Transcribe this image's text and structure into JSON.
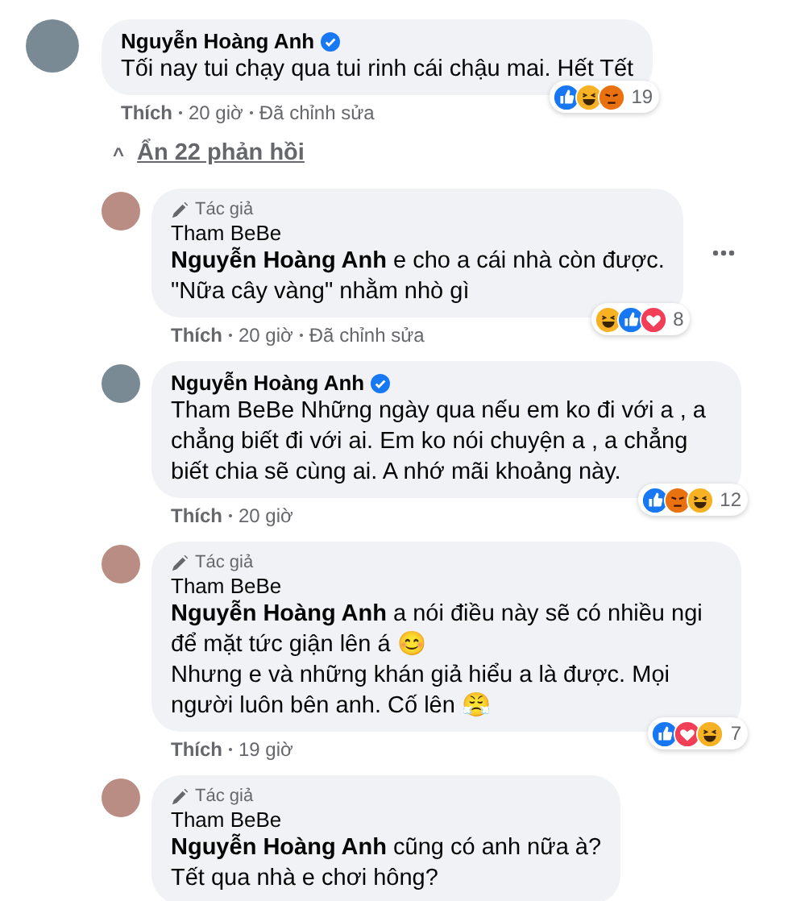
{
  "comment": {
    "author": "Nguyễn Hoàng Anh",
    "verified": true,
    "text": "Tối nay tui chạy qua tui rinh cái chậu mai. Hết Tết",
    "reactions": [
      {
        "kind": "like"
      },
      {
        "kind": "haha"
      },
      {
        "kind": "angry"
      }
    ],
    "reaction_count": "19",
    "meta": [
      "Thích",
      "20 giờ",
      "Đã chỉnh sửa"
    ]
  },
  "toggle_replies": {
    "icon": "^",
    "label": "Ẩn 22 phản hồi"
  },
  "replies": [
    {
      "badge": "Tác giả",
      "author": "Tham BeBe",
      "text": "**Nguyễn Hoàng Anh** e cho a cái nhà còn được.\n\"Nữa cây vàng\" nhằm nhò gì",
      "reactions": [
        {
          "kind": "haha"
        },
        {
          "kind": "like"
        },
        {
          "kind": "love"
        }
      ],
      "reaction_count": "8",
      "meta": [
        "Thích",
        "20 giờ",
        "Đã chỉnh sửa"
      ],
      "more_menu": true
    },
    {
      "author": "Nguyễn Hoàng Anh",
      "verified": true,
      "text": "Tham BeBe Những ngày qua nếu em ko đi với a , a chẳng biết đi với ai. Em ko nói chuyện a , a chẳng biết chia sẽ cùng ai. A nhớ mãi khoảng này.",
      "reactions": [
        {
          "kind": "like"
        },
        {
          "kind": "angry"
        },
        {
          "kind": "haha"
        }
      ],
      "reaction_count": "12",
      "meta": [
        "Thích",
        "20 giờ"
      ]
    },
    {
      "badge": "Tác giả",
      "author": "Tham BeBe",
      "text": "**Nguyễn Hoàng Anh** a nói điều này sẽ có nhiều ngi để mặt tức giận lên á 😊\nNhưng e và những khán giả hiểu a là được. Mọi người luôn bên anh. Cố lên 😤",
      "reactions": [
        {
          "kind": "like"
        },
        {
          "kind": "love"
        },
        {
          "kind": "haha"
        }
      ],
      "reaction_count": "7",
      "meta": [
        "Thích",
        "19 giờ"
      ]
    },
    {
      "badge": "Tác giả",
      "author": "Tham BeBe",
      "text": "**Nguyễn Hoàng Anh** cũng có anh nữa à?\nTết qua nhà e chơi hông?"
    }
  ]
}
